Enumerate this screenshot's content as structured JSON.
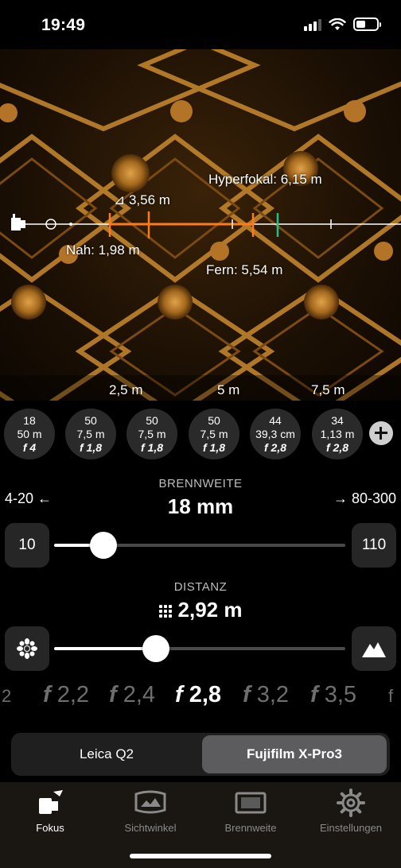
{
  "status": {
    "time": "19:49"
  },
  "overlay": {
    "hyperfocal": "Hyperfokal: 6,15 m",
    "delta": "⊿ 3,56 m",
    "near": "Nah: 1,98 m",
    "far": "Fern: 5,54 m",
    "scale": [
      "2,5 m",
      "5 m",
      "7,5 m"
    ]
  },
  "presets": [
    {
      "focal": "18",
      "dist": "50 m",
      "aperture": "f 4"
    },
    {
      "focal": "50",
      "dist": "7,5 m",
      "aperture": "f 1,8"
    },
    {
      "focal": "50",
      "dist": "7,5 m",
      "aperture": "f 1,8"
    },
    {
      "focal": "50",
      "dist": "7,5 m",
      "aperture": "f 1,8"
    },
    {
      "focal": "44",
      "dist": "39,3 cm",
      "aperture": "f 2,8"
    },
    {
      "focal": "34",
      "dist": "1,13 m",
      "aperture": "f 2,8"
    }
  ],
  "focal": {
    "label": "BRENNWEITE",
    "value": "18 mm",
    "prev_range": "4-20 ←",
    "next_range": "→ 80-300",
    "min": "10",
    "max": "110",
    "slider_fraction": 0.17
  },
  "distance": {
    "label": "DISTANZ",
    "value": "2,92 m",
    "slider_fraction": 0.35
  },
  "apertures": [
    "f 2,2",
    "f 2,4",
    "f 2,8",
    "f 3,2",
    "f 3,5"
  ],
  "aperture_selected": "f 2,8",
  "cameras": {
    "left": "Leica Q2",
    "right": "Fujifilm X-Pro3"
  },
  "tabs": [
    "Fokus",
    "Sichtwinkel",
    "Brennweite",
    "Einstellungen"
  ],
  "colors": {
    "accent_orange": "#ff7a1a",
    "hyperfocal_green": "#1fc28a"
  }
}
